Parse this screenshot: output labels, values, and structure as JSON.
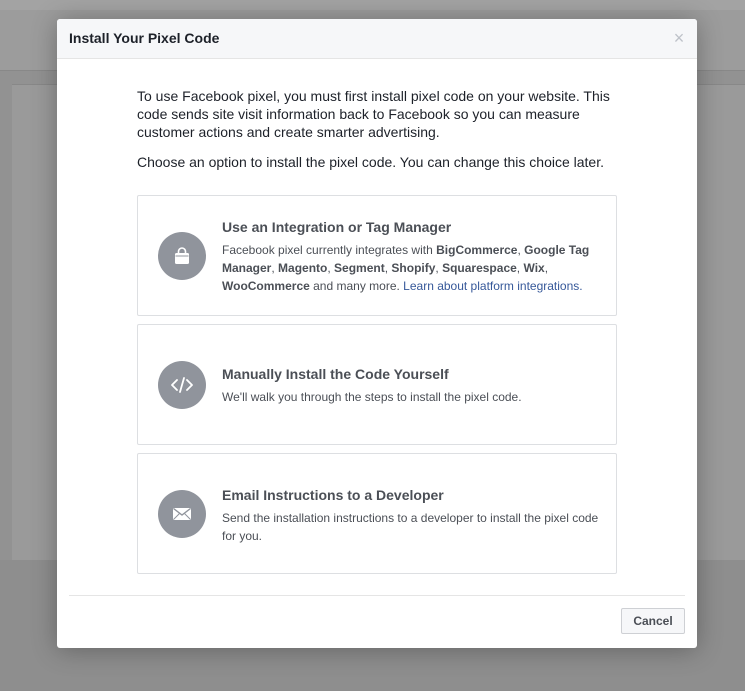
{
  "dialog": {
    "title": "Install Your Pixel Code",
    "close_glyph": "×",
    "intro_1": "To use Facebook pixel, you must first install pixel code on your website. This code sends site visit information back to Facebook so you can measure customer actions and create smarter advertising.",
    "intro_2": "Choose an option to install the pixel code. You can change this choice later.",
    "cancel_label": "Cancel"
  },
  "options": [
    {
      "title": "Use an Integration or Tag Manager",
      "icon": "shopping-bag-icon",
      "desc": {
        "prefix": "Facebook pixel currently integrates with ",
        "partners": [
          "BigCommerce",
          "Google Tag Manager",
          "Magento",
          "Segment",
          "Shopify",
          "Squarespace",
          "Wix",
          "WooCommerce"
        ],
        "sep": ", ",
        "suffix": " and many more. ",
        "link": "Learn about platform integrations."
      }
    },
    {
      "title": "Manually Install the Code Yourself",
      "icon": "code-icon",
      "desc": "We'll walk you through the steps to install the pixel code."
    },
    {
      "title": "Email Instructions to a Developer",
      "icon": "envelope-icon",
      "desc": "Send the installation instructions to a developer to install the pixel code for you."
    }
  ],
  "colors": {
    "link": "#365899",
    "icon_circle": "#90949c",
    "overlay": "#929292"
  }
}
